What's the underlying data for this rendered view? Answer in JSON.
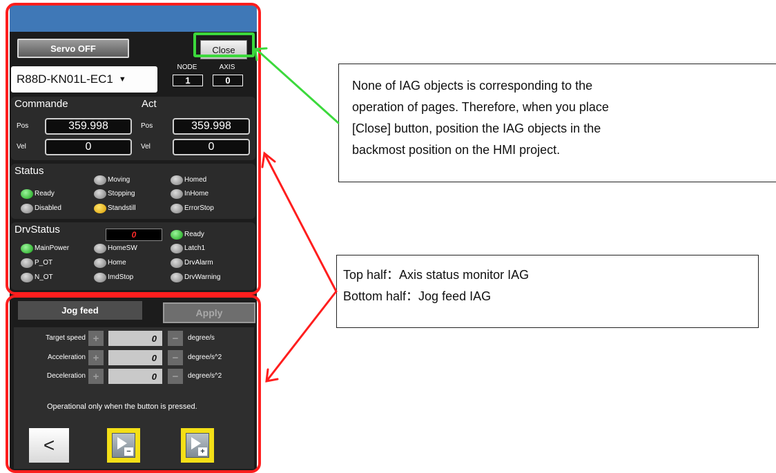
{
  "hmi": {
    "servo_button": "Servo OFF",
    "close_button": "Close",
    "model_select": "R88D-KN01L-EC1",
    "node": {
      "label": "NODE",
      "value": "1"
    },
    "axis": {
      "label": "AXIS",
      "value": "0"
    },
    "command": {
      "title": "Commande",
      "pos_label": "Pos",
      "pos_value": "359.998",
      "vel_label": "Vel",
      "vel_value": "0"
    },
    "actual": {
      "title": "Act",
      "pos_label": "Pos",
      "pos_value": "359.998",
      "vel_label": "Vel",
      "vel_value": "0"
    },
    "status": {
      "title": "Status",
      "leds": [
        {
          "label": "Moving",
          "color": "gray"
        },
        {
          "label": "Homed",
          "color": "gray"
        },
        {
          "label": "Ready",
          "color": "green"
        },
        {
          "label": "Stopping",
          "color": "gray"
        },
        {
          "label": "InHome",
          "color": "gray"
        },
        {
          "label": "Disabled",
          "color": "gray"
        },
        {
          "label": "Standstill",
          "color": "yellow"
        },
        {
          "label": "ErrorStop",
          "color": "gray"
        }
      ]
    },
    "drv_status": {
      "title": "DrvStatus",
      "code": "0",
      "leds": [
        {
          "label": "Ready",
          "color": "green"
        },
        {
          "label": "MainPower",
          "color": "green"
        },
        {
          "label": "HomeSW",
          "color": "gray"
        },
        {
          "label": "Latch1",
          "color": "gray"
        },
        {
          "label": "P_OT",
          "color": "gray"
        },
        {
          "label": "Home",
          "color": "gray"
        },
        {
          "label": "DrvAlarm",
          "color": "gray"
        },
        {
          "label": "N_OT",
          "color": "gray"
        },
        {
          "label": "ImdStop",
          "color": "gray"
        },
        {
          "label": "DrvWarning",
          "color": "gray"
        }
      ]
    },
    "jog": {
      "tab": "Jog feed",
      "apply_button": "Apply",
      "rows": [
        {
          "label": "Target speed",
          "plus": "+",
          "value": "0",
          "minus": "−",
          "unit": "degree/s"
        },
        {
          "label": "Acceleration",
          "plus": "+",
          "value": "0",
          "minus": "−",
          "unit": "degree/s^2"
        },
        {
          "label": "Deceleration",
          "plus": "+",
          "value": "0",
          "minus": "−",
          "unit": "degree/s^2"
        }
      ],
      "note": "Operational only when the button is pressed.",
      "back_glyph": "<",
      "minus_mark": "−",
      "plus_mark": "+"
    },
    "colors": {
      "header": "#3f78b7",
      "panel": "#1c1c1c",
      "annotation_red": "#ff1e1e",
      "annotation_green": "#3cd93c"
    }
  },
  "callouts": {
    "close_note": [
      "None of IAG objects is corresponding to the",
      "operation of pages. Therefore, when you place",
      "[Close] button, position the IAG objects in the",
      "backmost position on the HMI project."
    ],
    "halves_note": [
      "Top half：Axis status monitor IAG",
      "Bottom half：Jog feed IAG"
    ]
  }
}
